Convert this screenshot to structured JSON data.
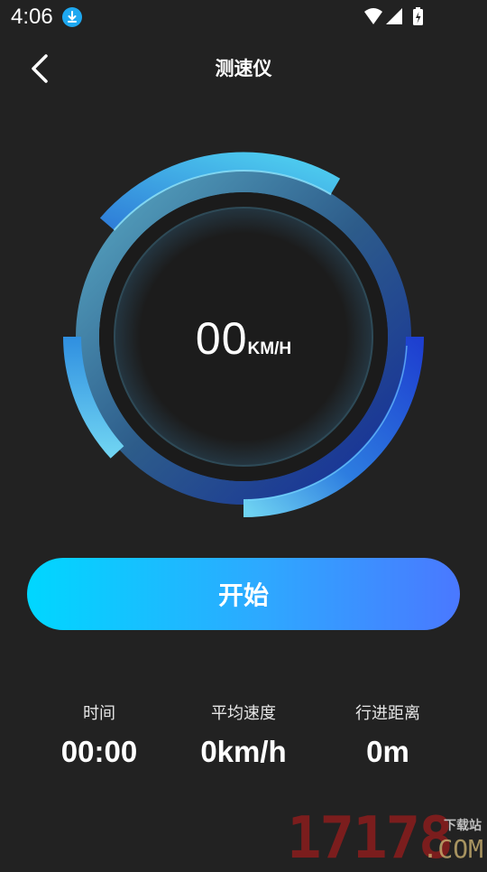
{
  "status_bar": {
    "time": "4:06",
    "icons": [
      "download-icon",
      "wifi-icon",
      "signal-icon",
      "battery-charging-icon"
    ]
  },
  "header": {
    "title": "测速仪",
    "back_icon": "chevron-left-icon"
  },
  "gauge": {
    "speed_value": "00",
    "speed_unit": "KM/H"
  },
  "actions": {
    "start_label": "开始"
  },
  "stats": {
    "time_label": "时间",
    "time_value": "00:00",
    "avg_speed_label": "平均速度",
    "avg_speed_value": "0km/h",
    "distance_label": "行进距离",
    "distance_value": "0m"
  },
  "watermark": {
    "number": "17178",
    "cn": "下载站",
    "com": ".COM"
  },
  "colors": {
    "background": "#222222",
    "accent_start": "#00d7ff",
    "accent_end": "#4a78ff"
  }
}
